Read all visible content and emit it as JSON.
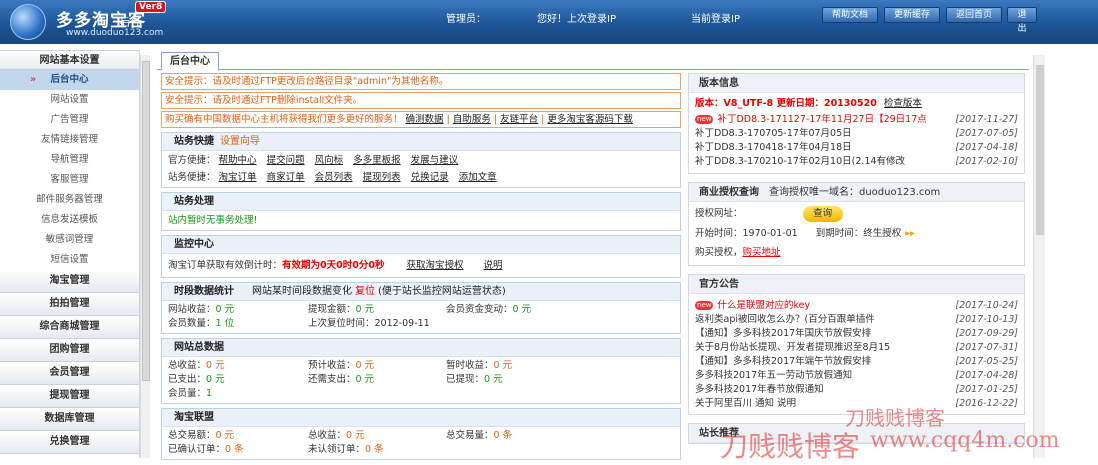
{
  "header": {
    "logo_text": "多多淘宝客",
    "logo_sub": "后台",
    "version_badge": "Ver8",
    "logo_url": "www.duoduo123.com",
    "admin_label": "管理员：",
    "greeting": "您好！上次登录IP",
    "current_ip_label": "当前登录IP",
    "buttons": [
      "帮助文档",
      "更新缓存",
      "返回首页",
      "退出"
    ]
  },
  "sidebar": {
    "title": "网站基本设置",
    "items": [
      "后台中心",
      "网站设置",
      "广告管理",
      "友情链接管理",
      "导航管理",
      "客服管理",
      "邮件服务器管理",
      "信息发送模板",
      "敏感词管理",
      "短信设置"
    ],
    "groups": [
      "淘宝管理",
      "拍拍管理",
      "综合商城管理",
      "团购管理",
      "会员管理",
      "提现管理",
      "数据库管理",
      "兑换管理"
    ]
  },
  "tab": {
    "label": "后台中心"
  },
  "notices": {
    "n1": "安全提示：请及时通过FTP更改后台路径目录\"admin\"为其他名称。",
    "n2": "安全提示：请及时通过FTP删除install文件夹。",
    "n3_text": "购买确有中国数据中心主机将获得我们更多更好的服务！",
    "n3_links": [
      "确测数据",
      "自助服务",
      "友链平台",
      "更多淘宝客源码下载"
    ]
  },
  "shortcuts": {
    "title": "站务快捷",
    "wizard": "设置向导",
    "row1_label": "官方便捷：",
    "row1": [
      "帮助中心",
      "提交问题",
      "风向标",
      "多多里板报",
      "发展与建议"
    ],
    "row2_label": "站务便捷：",
    "row2": [
      "淘宝订单",
      "商家订单",
      "会员列表",
      "提现列表",
      "兑换记录",
      "添加文章"
    ]
  },
  "handling": {
    "title": "站务处理",
    "text": "站内暂时无事务处理!"
  },
  "monitor": {
    "title": "监控中心",
    "label": "淘宝订单获取有效倒计时：",
    "value": "有效期为0天0时0分0秒",
    "link1": "获取淘宝授权",
    "link2": "说明"
  },
  "period": {
    "title": "时段数据统计",
    "desc": "网站某时间段数据变化",
    "reset": "复位",
    "note": "(便于站长监控网站运营状态)",
    "cells": [
      {
        "label": "网站收益：",
        "value": "0 元"
      },
      {
        "label": "提现金额：",
        "value": "0 元"
      },
      {
        "label": "会员资金变动：",
        "value": "0 元"
      },
      {
        "label": "会员数量：",
        "value": "1 位"
      },
      {
        "label": "上次复位时间：",
        "value": "2012-09-11"
      },
      {
        "label": "",
        "value": ""
      }
    ]
  },
  "total": {
    "title": "网站总数据",
    "cells": [
      {
        "label": "总收益：",
        "value": "0 元"
      },
      {
        "label": "预计收益：",
        "value": "0 元"
      },
      {
        "label": "暂时收益：",
        "value": "0 元"
      },
      {
        "label": "已支出：",
        "value": "0 元"
      },
      {
        "label": "还需支出：",
        "value": "0 元"
      },
      {
        "label": "已提现：",
        "value": "0 元"
      },
      {
        "label": "会员量：",
        "value": "1"
      },
      {
        "label": "",
        "value": ""
      },
      {
        "label": "",
        "value": ""
      }
    ]
  },
  "alliance": {
    "title": "淘宝联盟",
    "cells": [
      {
        "label": "总交易额：",
        "value": "0 元"
      },
      {
        "label": "总收益：",
        "value": "0 元"
      },
      {
        "label": "总交易量：",
        "value": "0 条"
      },
      {
        "label": "已确认订单：",
        "value": "0 条"
      },
      {
        "label": "未认领订单：",
        "value": "0 条"
      },
      {
        "label": "",
        "value": ""
      }
    ]
  },
  "version": {
    "title": "版本信息",
    "line": "版本：V8_UTF-8 更新日期：20130520",
    "check": "检查版本",
    "patches": [
      {
        "text": "补丁DD8.3-171127-17年11月27日【29日17点",
        "date": "[2017-11-27]",
        "new": true
      },
      {
        "text": "补丁DD8.3-170705-17年07月05日",
        "date": "[2017-07-05]",
        "new": false
      },
      {
        "text": "补丁DD8.3-170418-17年04月18日",
        "date": "[2017-04-18]",
        "new": false
      },
      {
        "text": "补丁DD8.3-170210-17年02月10日(2.14有修改",
        "date": "[2017-02-10]",
        "new": false
      }
    ]
  },
  "license": {
    "title": "商业授权查询",
    "desc": "查询授权唯一域名：duoduo123.com",
    "url_label": "授权网址：",
    "query": "查询",
    "start_label": "开始时间：",
    "start": "1970-01-01",
    "end_label": "到期时间：",
    "end": "终生授权",
    "buy_label": "购买授权，",
    "buy_link": "购买地址"
  },
  "announcements": {
    "title": "官方公告",
    "items": [
      {
        "text": "什么是联盟对应的key",
        "date": "[2017-10-24]",
        "new": true
      },
      {
        "text": "返利类api被回收怎么办？(百分百跟单插件",
        "date": "[2017-10-13]",
        "new": false
      },
      {
        "text": "【通知】多多科技2017年国庆节放假安排",
        "date": "[2017-09-29]",
        "new": false
      },
      {
        "text": "关于8月份站长提现、开发者提现推迟至8月15",
        "date": "[2017-07-31]",
        "new": false
      },
      {
        "text": "【通知】多多科技2017年端午节放假安排",
        "date": "[2017-05-25]",
        "new": false
      },
      {
        "text": "多多科技2017年五一劳动节放假通知",
        "date": "[2017-04-28]",
        "new": false
      },
      {
        "text": "多多科技2017年春节放假通知",
        "date": "[2017-01-25]",
        "new": false
      },
      {
        "text": "关于阿里百川 通知 说明",
        "date": "[2016-12-22]",
        "new": false
      }
    ]
  },
  "last_box": {
    "title": "站长推荐"
  },
  "watermark": {
    "w1": "刀贱贱博客",
    "w2": "刀贱贱博客",
    "w3": "www.cqq4m.com"
  }
}
